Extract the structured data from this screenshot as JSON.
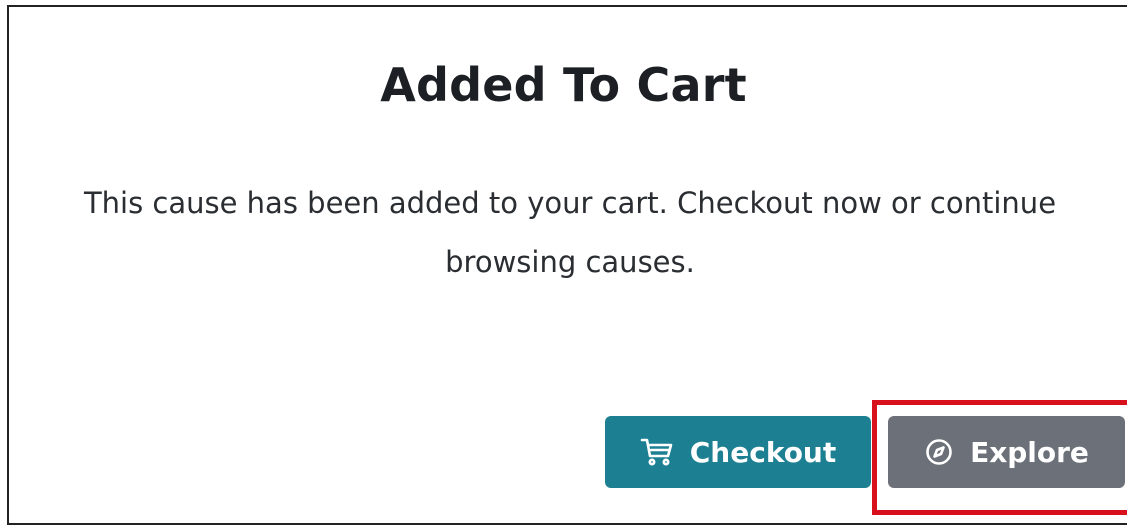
{
  "dialog": {
    "title": "Added To Cart",
    "message": "This cause has been added to your cart. Checkout now or continue browsing causes."
  },
  "actions": {
    "checkout_label": "Checkout",
    "checkout_icon": "shopping-cart-icon",
    "explore_label": "Explore",
    "explore_icon": "compass-icon"
  },
  "colors": {
    "checkout_bg": "#1c7f92",
    "explore_bg": "#6c7079",
    "highlight": "#d8101b"
  }
}
